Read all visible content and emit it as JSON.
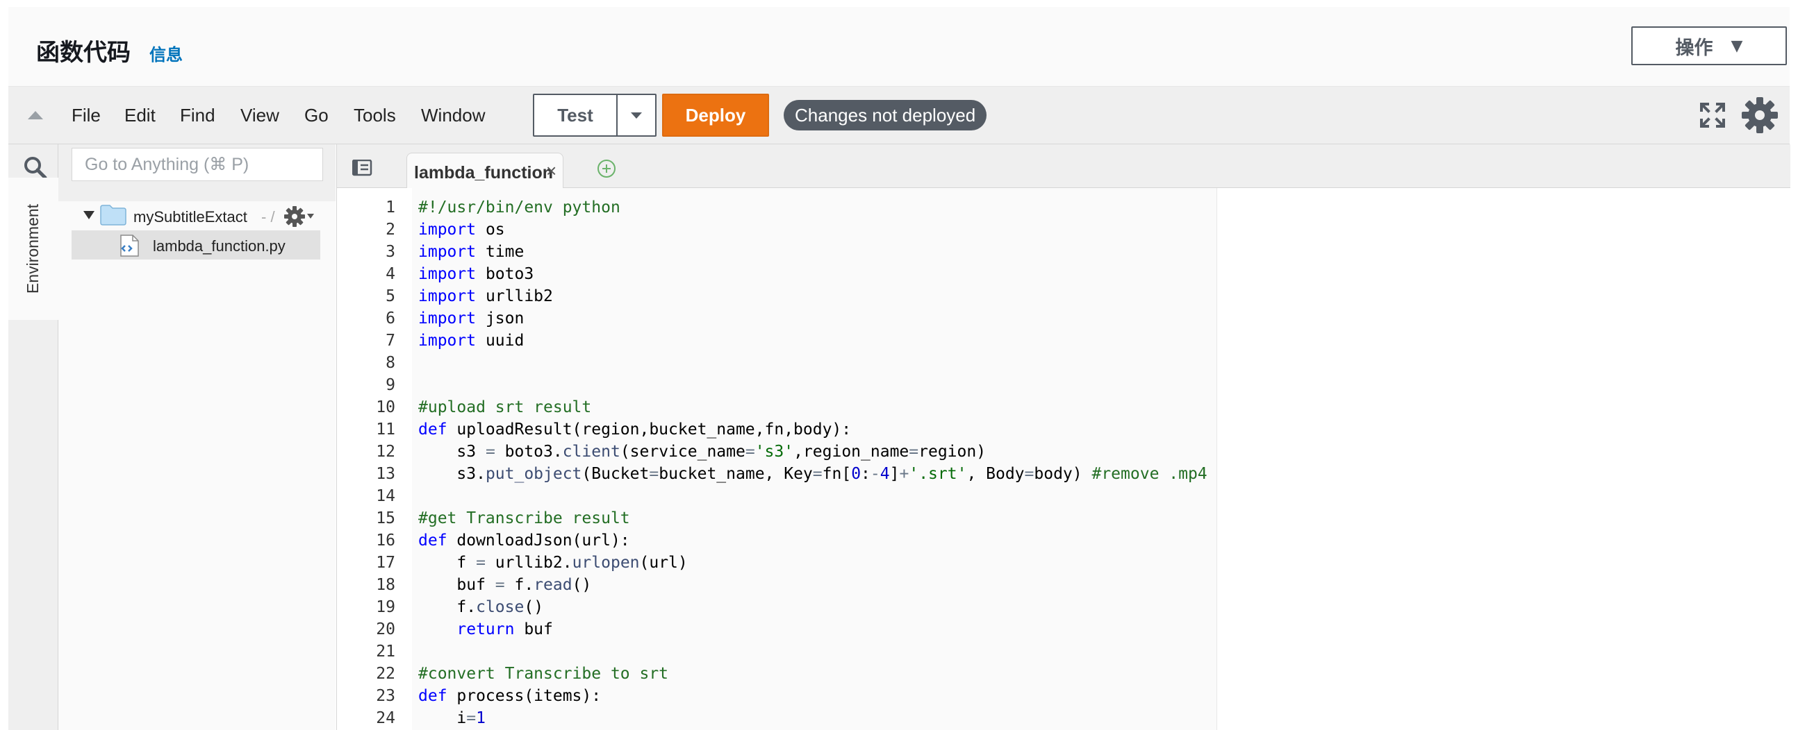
{
  "header": {
    "title": "函数代码",
    "info_link": "信息",
    "actions_label": "操作"
  },
  "toolbar": {
    "menu": [
      "File",
      "Edit",
      "Find",
      "View",
      "Go",
      "Tools",
      "Window"
    ],
    "test_label": "Test",
    "deploy_label": "Deploy",
    "status_badge": "Changes not deployed"
  },
  "sidebar": {
    "environment_tab": "Environment",
    "search_placeholder": "Go to Anything (⌘ P)",
    "folder_name": "mySubtitleExtact",
    "folder_separator": "- /",
    "file_name": "lambda_function.py"
  },
  "editor": {
    "tab_label": "lambda_function",
    "tab_close": "×",
    "lines": [
      [
        [
          "comment",
          "#!/usr/bin/env python"
        ]
      ],
      [
        [
          "keyword",
          "import"
        ],
        [
          "plain",
          " os"
        ]
      ],
      [
        [
          "keyword",
          "import"
        ],
        [
          "plain",
          " time"
        ]
      ],
      [
        [
          "keyword",
          "import"
        ],
        [
          "plain",
          " boto3"
        ]
      ],
      [
        [
          "keyword",
          "import"
        ],
        [
          "plain",
          " urllib2"
        ]
      ],
      [
        [
          "keyword",
          "import"
        ],
        [
          "plain",
          " json"
        ]
      ],
      [
        [
          "keyword",
          "import"
        ],
        [
          "plain",
          " uuid"
        ]
      ],
      [],
      [],
      [
        [
          "comment",
          "#upload srt result"
        ]
      ],
      [
        [
          "keyword",
          "def"
        ],
        [
          "plain",
          " uploadResult(region,bucket_name,fn,body):"
        ]
      ],
      [
        [
          "plain",
          "    s3 "
        ],
        [
          "op",
          "="
        ],
        [
          "plain",
          " boto3."
        ],
        [
          "method",
          "client"
        ],
        [
          "plain",
          "(service_name"
        ],
        [
          "op",
          "="
        ],
        [
          "string",
          "'s3'"
        ],
        [
          "plain",
          ",region_name"
        ],
        [
          "op",
          "="
        ],
        [
          "plain",
          "region)"
        ]
      ],
      [
        [
          "plain",
          "    s3."
        ],
        [
          "method",
          "put_object"
        ],
        [
          "plain",
          "(Bucket"
        ],
        [
          "op",
          "="
        ],
        [
          "plain",
          "bucket_name, Key"
        ],
        [
          "op",
          "="
        ],
        [
          "plain",
          "fn["
        ],
        [
          "number",
          "0"
        ],
        [
          "plain",
          ":"
        ],
        [
          "op",
          "-"
        ],
        [
          "number",
          "4"
        ],
        [
          "plain",
          "]"
        ],
        [
          "op",
          "+"
        ],
        [
          "string",
          "'.srt'"
        ],
        [
          "plain",
          ", Body"
        ],
        [
          "op",
          "="
        ],
        [
          "plain",
          "body) "
        ],
        [
          "comment",
          "#remove .mp4"
        ]
      ],
      [],
      [
        [
          "comment",
          "#get Transcribe result"
        ]
      ],
      [
        [
          "keyword",
          "def"
        ],
        [
          "plain",
          " downloadJson(url):"
        ]
      ],
      [
        [
          "plain",
          "    f "
        ],
        [
          "op",
          "="
        ],
        [
          "plain",
          " urllib2."
        ],
        [
          "method",
          "urlopen"
        ],
        [
          "plain",
          "(url)"
        ]
      ],
      [
        [
          "plain",
          "    buf "
        ],
        [
          "op",
          "="
        ],
        [
          "plain",
          " f."
        ],
        [
          "method",
          "read"
        ],
        [
          "plain",
          "()"
        ]
      ],
      [
        [
          "plain",
          "    f."
        ],
        [
          "method",
          "close"
        ],
        [
          "plain",
          "()"
        ]
      ],
      [
        [
          "plain",
          "    "
        ],
        [
          "keyword",
          "return"
        ],
        [
          "plain",
          " buf"
        ]
      ],
      [],
      [
        [
          "comment",
          "#convert Transcribe to srt"
        ]
      ],
      [
        [
          "keyword",
          "def"
        ],
        [
          "plain",
          " process(items):"
        ]
      ],
      [
        [
          "plain",
          "    i"
        ],
        [
          "op",
          "="
        ],
        [
          "number",
          "1"
        ]
      ]
    ]
  },
  "colors": {
    "deploy": "#ec7211",
    "badge": "#545b64",
    "keyword": "#0000ff",
    "comment": "#236e24",
    "link": "#0073bb"
  },
  "icons": [
    "collapse-up-icon",
    "fullscreen-icon",
    "gear-icon",
    "search-icon",
    "folder-icon",
    "python-file-icon",
    "tab-list-icon",
    "add-tab-icon"
  ]
}
